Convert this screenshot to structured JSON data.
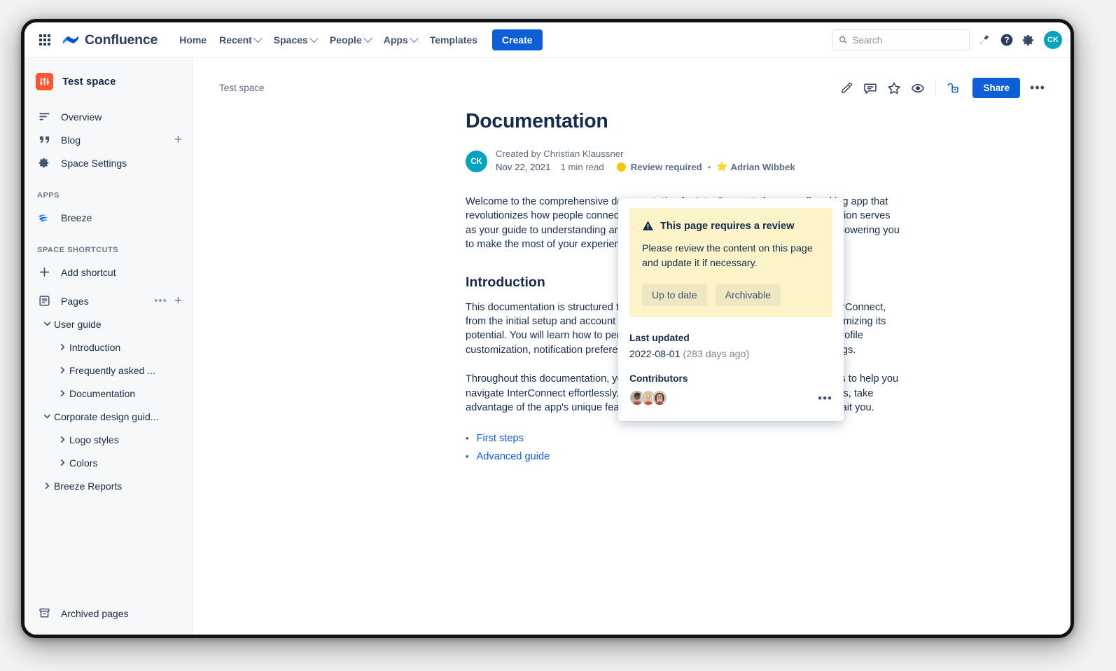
{
  "topnav": {
    "app_switcher_icon": "grid-apps-icon",
    "brand": "Confluence",
    "items": [
      {
        "label": "Home",
        "has_chevron": false
      },
      {
        "label": "Recent",
        "has_chevron": true
      },
      {
        "label": "Spaces",
        "has_chevron": true
      },
      {
        "label": "People",
        "has_chevron": true
      },
      {
        "label": "Apps",
        "has_chevron": true
      },
      {
        "label": "Templates",
        "has_chevron": false
      }
    ],
    "create_label": "Create",
    "search_placeholder": "Search",
    "search_value": "",
    "icons": [
      "notifications-icon",
      "help-icon",
      "settings-icon"
    ],
    "user_initials": "CK"
  },
  "sidebar": {
    "space_name": "Test space",
    "space_icon": "sliders-icon",
    "nav": [
      {
        "label": "Overview",
        "icon": "overview-icon"
      },
      {
        "label": "Blog",
        "icon": "quote-icon",
        "action": "add-blog-icon"
      },
      {
        "label": "Space Settings",
        "icon": "gear-icon"
      }
    ],
    "apps_section": "APPS",
    "apps": [
      {
        "label": "Breeze",
        "icon": "breeze-icon"
      }
    ],
    "shortcuts_section": "SPACE SHORTCUTS",
    "add_shortcut_label": "Add shortcut",
    "pages_label": "Pages",
    "tree": [
      {
        "label": "User guide",
        "level": 0,
        "state": "expanded"
      },
      {
        "label": "Introduction",
        "level": 1,
        "state": "collapsed"
      },
      {
        "label": "Frequently asked ...",
        "level": 1,
        "state": "collapsed"
      },
      {
        "label": "Documentation",
        "level": 1,
        "state": "collapsed"
      },
      {
        "label": "Corporate design guid...",
        "level": 0,
        "state": "expanded"
      },
      {
        "label": "Logo styles",
        "level": 1,
        "state": "collapsed"
      },
      {
        "label": "Colors",
        "level": 1,
        "state": "collapsed"
      },
      {
        "label": "Breeze Reports",
        "level": 0,
        "state": "collapsed"
      }
    ],
    "archived_label": "Archived pages"
  },
  "page": {
    "breadcrumb": "Test space",
    "title": "Documentation",
    "toolbar_icons": [
      "edit-pencil-icon",
      "comment-icon",
      "star-icon",
      "watch-eye-icon",
      "restrictions-lock-icon"
    ],
    "share_label": "Share",
    "more_label": "•••",
    "byline": {
      "avatar_initials": "CK",
      "created_by": "Created by Christian Klaussner",
      "date": "Nov 22, 2021",
      "read_time": "1 min read",
      "status_label": "Review required",
      "status_color": "#ffc400",
      "separator": "•",
      "reviewer": "Adrian Wibbek",
      "reviewer_icon": "⭐"
    },
    "paragraphs": [
      "Welcome to the comprehensive documentation for InterConnect, the groundbreaking app that revolutionizes how people connect and interact in the digital world. This documentation serves as your guide to understanding and unlocking the full potential of InterConnect, empowering you to make the most of your experience.",
      "This documentation is structured to provide you a step-by-step journey through InterConnect, from the initial setup and account creation to exploring its diverse features and maximizing its potential. You will learn how to personalize your profile on InterConnect, including profile customization, notification preferences, connection management, and privacy settings.",
      "Throughout this documentation, you will find helpful tips, insights, and best practices to help you navigate InterConnect effortlessly. We encourage you to explore the various sections, take advantage of the app's unique features, and discover the vast opportunities that await you."
    ],
    "intro_heading": "Introduction",
    "links": [
      {
        "label": "First steps"
      },
      {
        "label": "Advanced guide"
      }
    ]
  },
  "review_popup": {
    "banner_title": "This page requires a review",
    "banner_icon": "warning-icon",
    "banner_text": "Please review the content on this page and update it if necessary.",
    "buttons": [
      {
        "label": "Up to date"
      },
      {
        "label": "Archivable"
      }
    ],
    "last_updated_label": "Last updated",
    "last_updated_date": "2022-08-01",
    "last_updated_relative": "(283 days ago)",
    "contributors_label": "Contributors",
    "contributor_count": 3,
    "more_label": "•••"
  },
  "colors": {
    "brand_blue": "#0c5fd6",
    "space_red": "#ff5630",
    "avatar_teal": "#00a3bf",
    "banner_yellow": "#fdf3c8",
    "status_yellow": "#ffc400",
    "sidebar_bg": "#f7f8f9",
    "text_dark": "#172b4d"
  }
}
